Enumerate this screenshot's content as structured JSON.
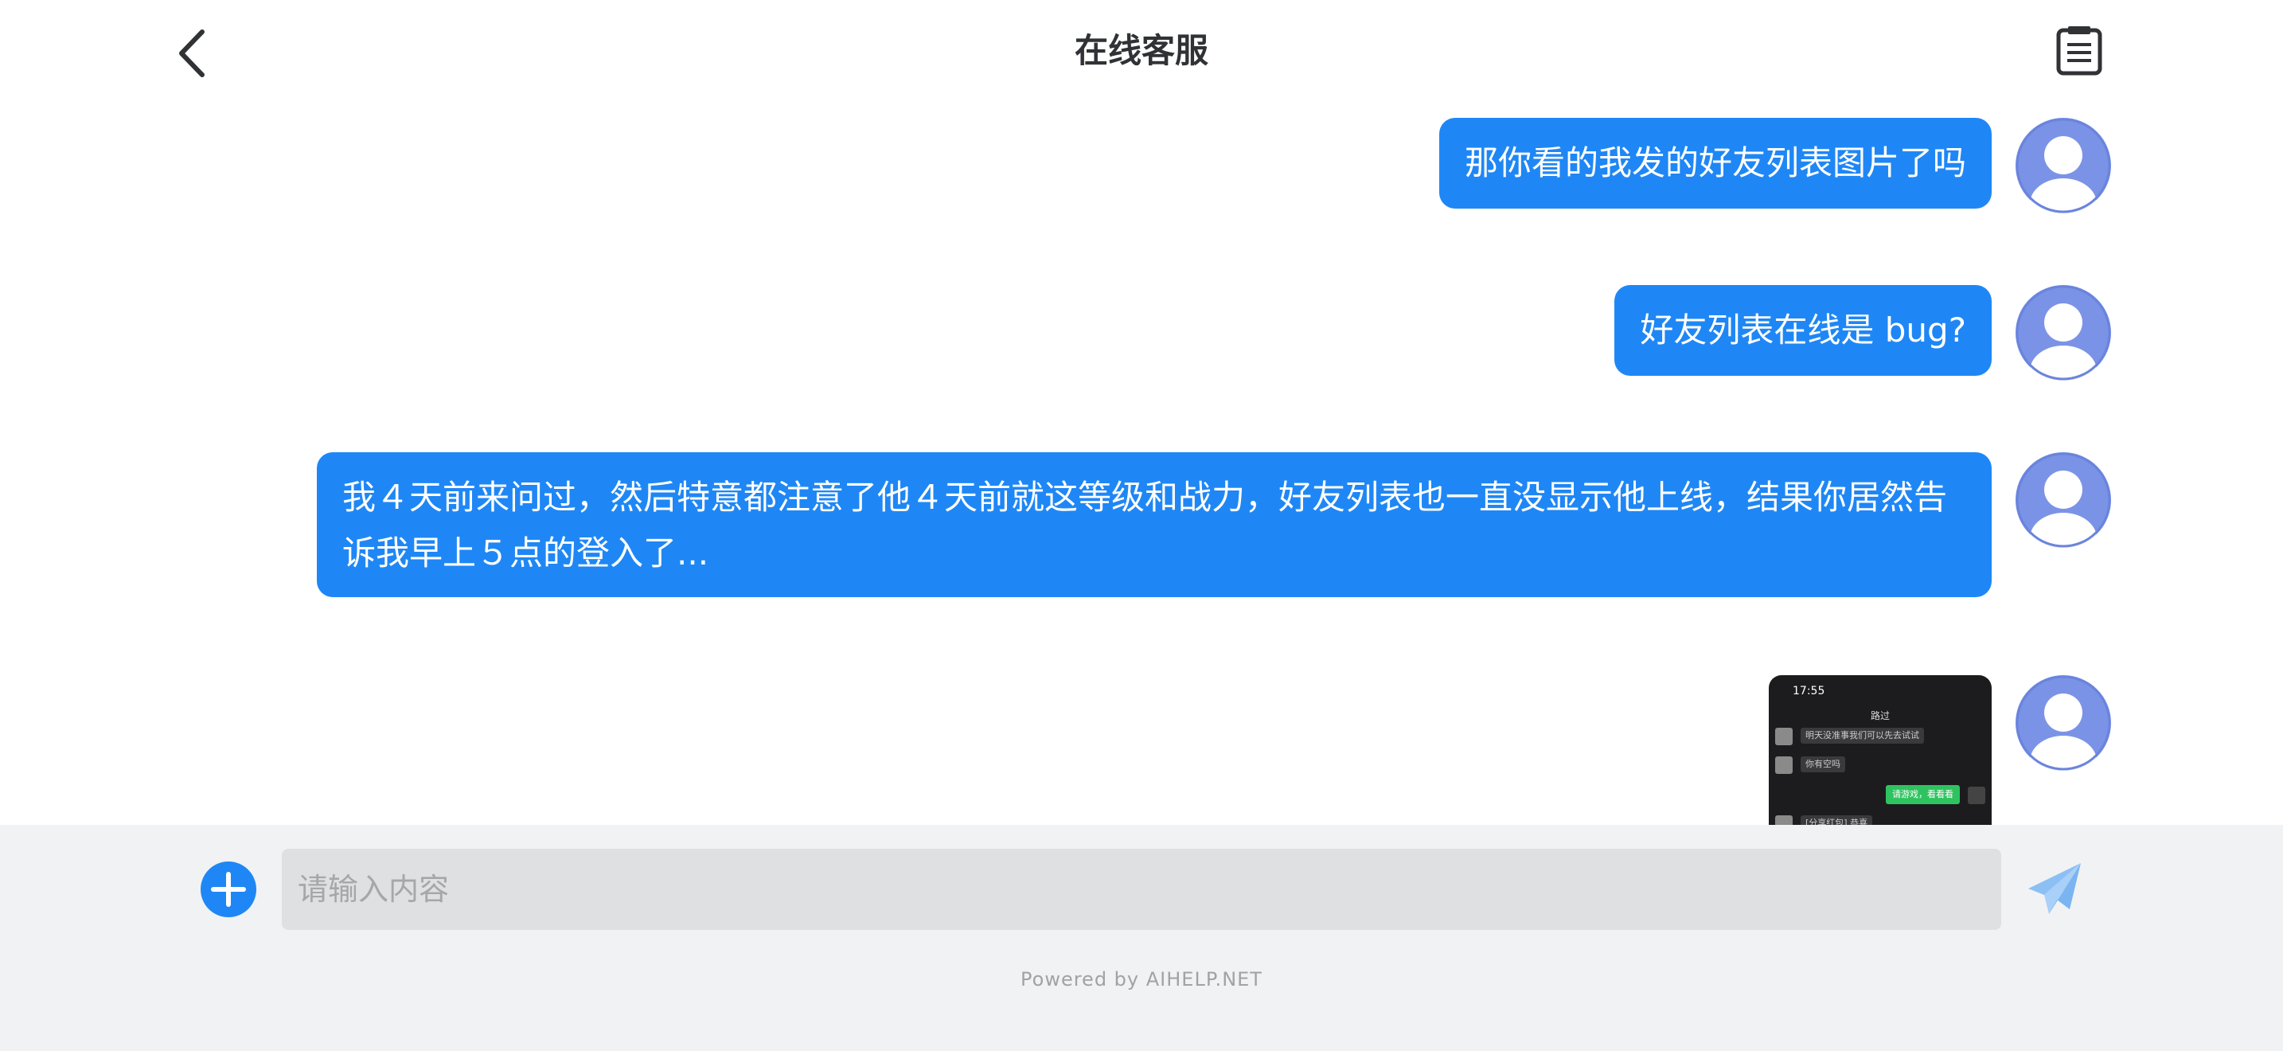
{
  "header": {
    "title": "在线客服",
    "back_icon": "chevron-left-icon",
    "ticket_icon": "clipboard-icon"
  },
  "messages": [
    {
      "type": "text",
      "text": "那你看的我发的好友列表图片了吗"
    },
    {
      "type": "text",
      "text": "好友列表在线是 bug?"
    },
    {
      "type": "text",
      "text": "我４天前来问过，然后特意都注意了他４天前就这等级和战力，好友列表也一直没显示他上线，结果你居然告诉我早上５点的登入了..."
    },
    {
      "type": "image",
      "thumbnail": {
        "status_time": "17:55",
        "title": "路过",
        "rows": [
          "明天没准事我们可以先去试试",
          "你有空吗"
        ],
        "green_bubble": "请游戏，看看看",
        "bottom_row": "[分享红包] 恭喜"
      }
    }
  ],
  "composer": {
    "placeholder": "请输入内容",
    "plus_icon": "plus-icon",
    "send_icon": "paper-plane-icon"
  },
  "footer": {
    "powered_by": "Powered by AIHELP.NET"
  },
  "colors": {
    "accent": "#1f87f5",
    "avatar": "#7b93e6",
    "footer_bg": "#f1f2f4",
    "input_bg": "#dfe0e2"
  }
}
